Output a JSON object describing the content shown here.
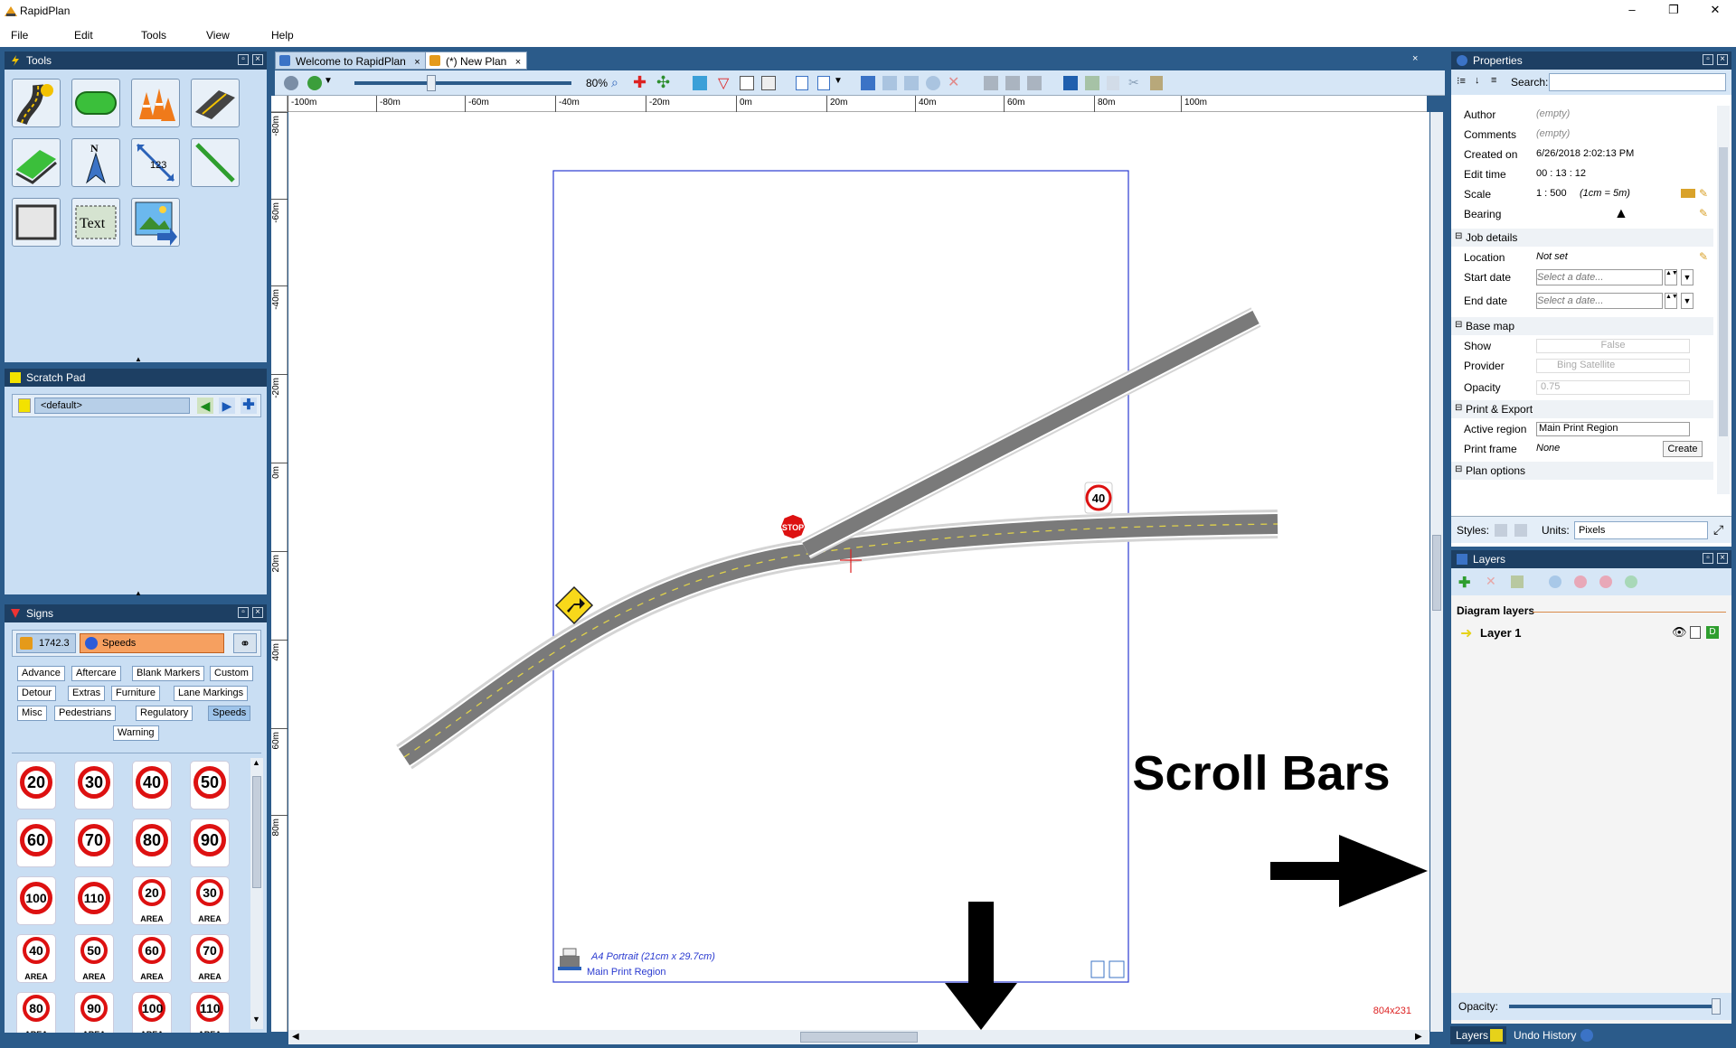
{
  "app": {
    "title": "RapidPlan"
  },
  "menu": [
    "File",
    "Edit",
    "Tools",
    "View",
    "Help"
  ],
  "tabs": [
    {
      "label": "Welcome to RapidPlan",
      "active": false
    },
    {
      "label": "(*) New Plan",
      "active": true
    }
  ],
  "toolbar": {
    "zoom": "80%"
  },
  "panels": {
    "tools": {
      "title": "Tools",
      "items": [
        "road-tool",
        "island-tool",
        "cones-tool",
        "lane-tool",
        "grass-tool",
        "north-arrow-tool",
        "measure-tool",
        "line-tool",
        "rectangle-tool",
        "text-tool",
        "image-tool"
      ]
    },
    "scratch": {
      "title": "Scratch Pad",
      "default": "<default>"
    },
    "signs": {
      "title": "Signs",
      "code": "1742.3",
      "category": "Speeds",
      "chips": [
        "Advance",
        "Aftercare",
        "Blank Markers",
        "Custom",
        "Detour",
        "Extras",
        "Furniture",
        "Lane Markings",
        "Misc",
        "Pedestrians",
        "Regulatory",
        "Speeds",
        "Warning"
      ],
      "area_label": "AREA",
      "speed_signs": [
        "20",
        "30",
        "40",
        "50",
        "60",
        "70",
        "80",
        "90",
        "100",
        "110"
      ],
      "area_signs": [
        "20",
        "30",
        "40",
        "50",
        "60",
        "70",
        "80",
        "90",
        "100",
        "110"
      ]
    }
  },
  "ruler": {
    "h": [
      "-100m",
      "-80m",
      "-60m",
      "-40m",
      "-20m",
      "0m",
      "20m",
      "40m",
      "60m",
      "80m",
      "100m"
    ],
    "v": [
      "-80m",
      "-60m",
      "-40m",
      "-20m",
      "0m",
      "20m",
      "40m",
      "60m",
      "80m"
    ]
  },
  "canvas": {
    "print_region": {
      "paper": "A4 Portrait (21cm x 29.7cm)",
      "name": "Main Print Region"
    },
    "speed_sign": "40",
    "stop_sign": "STOP",
    "size_readout": "804x231",
    "annotation": "Scroll Bars"
  },
  "properties": {
    "title": "Properties",
    "search_label": "Search:",
    "rows": [
      {
        "key": "Author",
        "value": "(empty)"
      },
      {
        "key": "Comments",
        "value": "(empty)"
      },
      {
        "key": "Created on",
        "value": "6/26/2018 2:02:13 PM"
      },
      {
        "key": "Edit time",
        "value": "00 : 13 : 12"
      },
      {
        "key": "Scale",
        "value": "1 : 500",
        "note": "(1cm = 5m)"
      },
      {
        "key": "Bearing",
        "value": ""
      }
    ],
    "job": {
      "title": "Job details",
      "location_k": "Location",
      "location_v": "Not set",
      "start_k": "Start date",
      "end_k": "End date",
      "date_placeholder": "Select a date..."
    },
    "basemap": {
      "title": "Base map",
      "show_k": "Show",
      "show_v": "False",
      "provider_k": "Provider",
      "provider_v": "Bing Satellite",
      "opacity_k": "Opacity",
      "opacity_v": "0.75"
    },
    "print": {
      "title": "Print & Export",
      "region_k": "Active region",
      "region_v": "Main Print Region",
      "frame_k": "Print frame",
      "frame_v": "None",
      "create": "Create"
    },
    "plan_options": "Plan options",
    "styles_label": "Styles:",
    "units_label": "Units:",
    "units_value": "Pixels"
  },
  "layers": {
    "title": "Layers",
    "section": "Diagram layers",
    "items": [
      "Layer 1"
    ],
    "opacity_label": "Opacity:",
    "opacity": 1.0
  },
  "bottom_tabs": [
    "Layers",
    "Undo History"
  ]
}
